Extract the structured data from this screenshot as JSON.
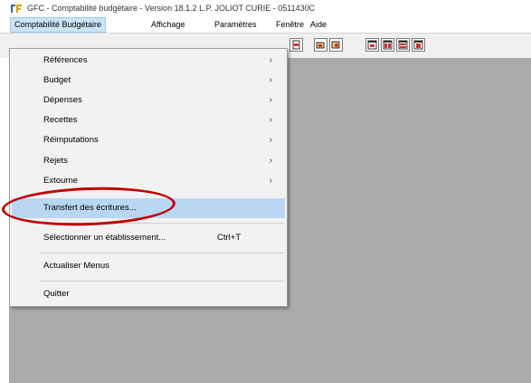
{
  "window": {
    "title": "GFC - Comptabilité budgétaire - Version 18.1.2  L.P. JOLIOT CURIE - 0511430C",
    "logo_icon": "gfc-app-logo-icon"
  },
  "menubar": {
    "items": [
      {
        "label": "Comptabilité Budgétaire",
        "active": true
      },
      {
        "label": "Affichage"
      },
      {
        "label": "Paramètres"
      },
      {
        "label": "Fenêtre"
      },
      {
        "label": "Aide"
      }
    ]
  },
  "toolbar": {
    "buttons": [
      "toolbar-icon-1",
      "toolbar-icon-2",
      "toolbar-icon-3",
      "toolbar-icon-4",
      "toolbar-icon-5",
      "toolbar-icon-6",
      "toolbar-icon-7"
    ]
  },
  "dropdown": {
    "items": [
      {
        "label": "Références",
        "submenu": true
      },
      {
        "label": "Budget",
        "submenu": true
      },
      {
        "label": "Dépenses",
        "submenu": true
      },
      {
        "label": "Recettes",
        "submenu": true
      },
      {
        "label": "Réimputations",
        "submenu": true
      },
      {
        "label": "Rejets",
        "submenu": true
      },
      {
        "label": "Extourne",
        "submenu": true
      },
      {
        "label": "Transfert des écritures...",
        "highlighted": true
      },
      {
        "label": "Sélectionner un établissement...",
        "shortcut": "Ctrl+T"
      },
      {
        "label": "Actualiser Menus"
      },
      {
        "label": "Quitter"
      }
    ]
  },
  "colors": {
    "workspace": "#aaaaaa",
    "menu_highlight": "#b9d7f3",
    "callout": "#c00000"
  }
}
